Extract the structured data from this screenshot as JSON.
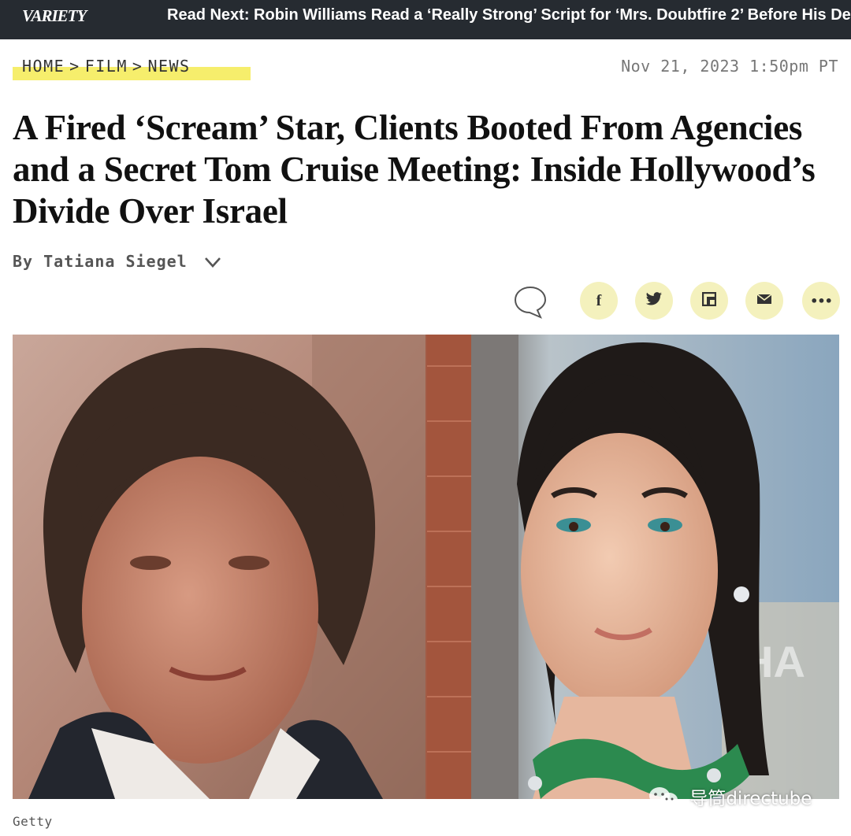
{
  "topbar": {
    "logo": "Variety",
    "read_next": "Read Next: Robin Williams Read a ‘Really Strong’ Script for ‘Mrs. Doubtfire 2’ Before His Death"
  },
  "breadcrumb": {
    "items": [
      "HOME",
      "FILM",
      "NEWS"
    ],
    "separator": ">"
  },
  "date": "Nov 21, 2023 1:50pm PT",
  "headline": "A Fired ‘Scream’ Star, Clients Booted From Agencies and a Secret Tom Cruise Meeting: Inside Hollywood’s Divide Over Israel",
  "byline": "By Tatiana Siegel",
  "share": {
    "comment_icon": "comment-bubble-icon",
    "buttons": [
      {
        "icon": "facebook-icon",
        "glyph": "f"
      },
      {
        "icon": "twitter-icon",
        "glyph": "twitter-bird"
      },
      {
        "icon": "flipboard-icon",
        "glyph": "flipboard"
      },
      {
        "icon": "email-icon",
        "glyph": "envelope"
      },
      {
        "icon": "more-icon",
        "glyph": "···"
      }
    ],
    "button_color": "#f4f1bd"
  },
  "hero": {
    "caption": "Getty"
  },
  "watermark": "导筒directube",
  "colors": {
    "topbar": "#262b31",
    "highlight": "#f6ee6c"
  }
}
